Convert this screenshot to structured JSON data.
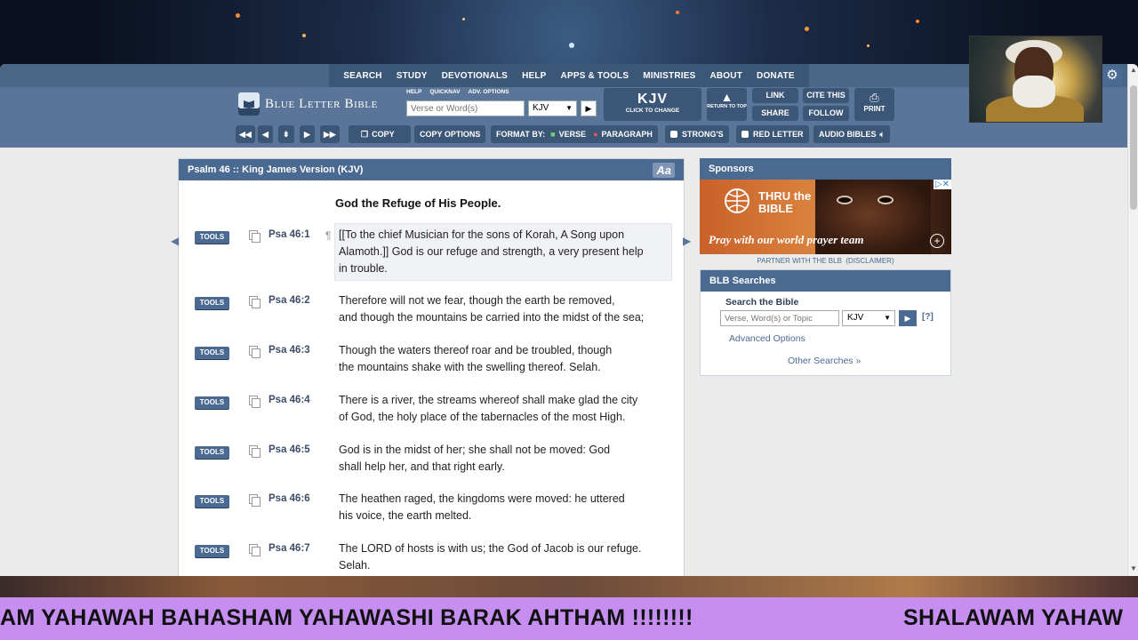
{
  "nav": {
    "items": [
      "SEARCH",
      "STUDY",
      "DEVOTIONALS",
      "HELP",
      "APPS & TOOLS",
      "MINISTRIES",
      "ABOUT",
      "DONATE"
    ]
  },
  "header": {
    "logo_text": "Blue Letter Bible",
    "mini_labels": [
      "HELP",
      "QUICKNAV",
      "ADV. OPTIONS"
    ],
    "verse_placeholder": "Verse or Word(s)",
    "version_select": "KJV",
    "version_big": "KJV",
    "version_small": "CLICK TO CHANGE",
    "return_top": "RETURN TO TOP",
    "link": "LINK",
    "cite": "CITE THIS",
    "share": "SHARE",
    "follow": "FOLLOW",
    "print": "PRINT"
  },
  "toolbar": {
    "copy": "COPY",
    "copy_options": "COPY OPTIONS",
    "format_by": "FORMAT BY:",
    "verse": "VERSE",
    "paragraph": "PARAGRAPH",
    "strongs": "STRONG'S",
    "red_letter": "RED LETTER",
    "audio_bibles": "AUDIO BIBLES"
  },
  "panel": {
    "title": "Psalm 46 :: King James Version (KJV)",
    "aa": "Aa",
    "heading": "God the Refuge of His People."
  },
  "verses": [
    {
      "tools": "TOOLS",
      "ref": "Psa 46:1",
      "line1": "[[To the chief Musician for the sons of Korah, A Song upon",
      "line2": "Alamoth.]] God is our refuge and strength, a very present help",
      "line3": "in trouble."
    },
    {
      "tools": "TOOLS",
      "ref": "Psa 46:2",
      "line1": "Therefore will not we fear, though the earth be removed,",
      "line2": "and though the mountains be carried into the midst of the sea;"
    },
    {
      "tools": "TOOLS",
      "ref": "Psa 46:3",
      "line1": "Though the waters thereof roar and be troubled, though",
      "line2": "the mountains shake with the swelling thereof. Selah."
    },
    {
      "tools": "TOOLS",
      "ref": "Psa 46:4",
      "line1": "There is a river, the streams whereof shall make glad the city",
      "line2": "of God, the holy place of the tabernacles of the most High."
    },
    {
      "tools": "TOOLS",
      "ref": "Psa 46:5",
      "line1": "God is in the midst of her; she shall not be moved: God",
      "line2": "shall help her, and that right early."
    },
    {
      "tools": "TOOLS",
      "ref": "Psa 46:6",
      "line1": "The heathen raged, the kingdoms were moved: he uttered",
      "line2": "his voice, the earth melted."
    },
    {
      "tools": "TOOLS",
      "ref": "Psa 46:7",
      "line1": "The LORD of hosts is with us; the God of Jacob is our refuge.",
      "line2": "Selah."
    }
  ],
  "sponsors": {
    "title": "Sponsors",
    "brand": "THRU the BIBLE",
    "tagline": "Pray with our world prayer team",
    "partner": "PARTNER WITH THE BLB",
    "disclaimer": "(DISCLAIMER)"
  },
  "search": {
    "title": "BLB Searches",
    "subtitle": "Search the Bible",
    "placeholder": "Verse, Word(s) or Topic",
    "version": "KJV",
    "help": "[?]",
    "advanced": "Advanced Options",
    "other": "Other Searches »"
  },
  "ticker": {
    "left": "AM YAHAWAH BAHASHAM YAHAWASHI BARAK AHTHAM !!!!!!!!",
    "right": "SHALAWAM YAHAW"
  },
  "colors": {
    "nav_dark": "#3b5676",
    "header_blue": "#5b7598",
    "panel_head": "#4b6a92",
    "ticker_bg": "#c58ef0"
  }
}
